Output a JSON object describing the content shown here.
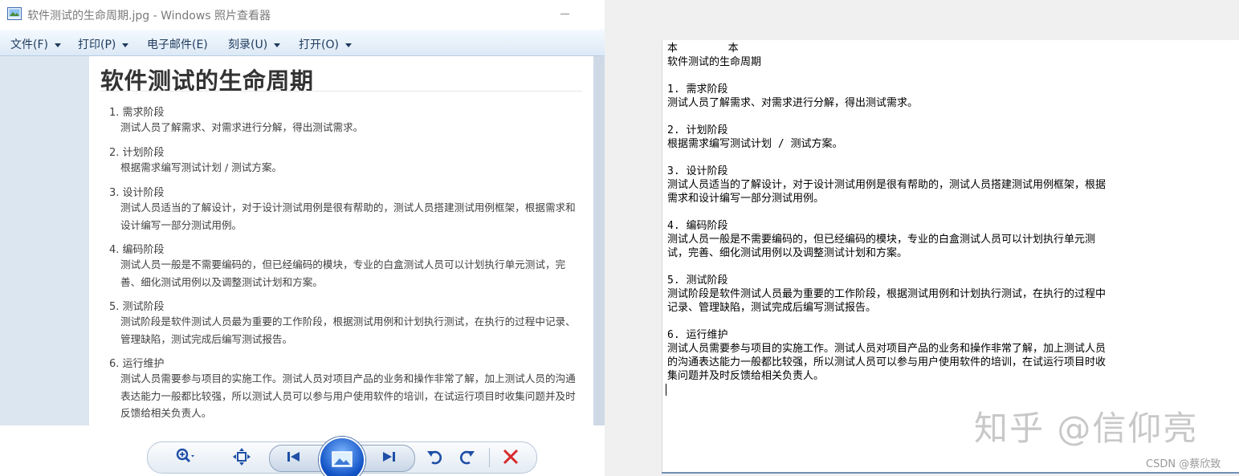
{
  "window": {
    "title": "软件测试的生命周期.jpg - Windows 照片查看器"
  },
  "menu": [
    {
      "label": "文件(F)"
    },
    {
      "label": "打印(P)"
    },
    {
      "label": "电子邮件(E)"
    },
    {
      "label": "刻录(U)"
    },
    {
      "label": "打开(O)"
    }
  ],
  "photo": {
    "title": "软件测试的生命周期",
    "sections": [
      {
        "head": "1. 需求阶段",
        "body": "测试人员了解需求、对需求进行分解，得出测试需求。"
      },
      {
        "head": "2. 计划阶段",
        "body": "根据需求编写测试计划 / 测试方案。"
      },
      {
        "head": "3. 设计阶段",
        "body": "测试人员适当的了解设计，对于设计测试用例是很有帮助的，测试人员搭建测试用例框架，根据需求和设计编写一部分测试用例。"
      },
      {
        "head": "4. 编码阶段",
        "body": "测试人员一般是不需要编码的，但已经编码的模块，专业的白盒测试人员可以计划执行单元测试，完善、细化测试用例以及调整测试计划和方案。"
      },
      {
        "head": "5. 测试阶段",
        "body": "测试阶段是软件测试人员最为重要的工作阶段，根据测试用例和计划执行测试，在执行的过程中记录、管理缺陷，测试完成后编写测试报告。"
      },
      {
        "head": "6. 运行维护",
        "body": "测试人员需要参与项目的实施工作。测试人员对项目产品的业务和操作非常了解，加上测试人员的沟通表达能力一般都比较强，所以测试人员可以参与用户使用软件的培训，在试运行项目时收集问题并及时反馈给相关负责人。"
      }
    ]
  },
  "editor": {
    "text": "本        本\n软件测试的生命周期\n\n1. 需求阶段\n测试人员了解需求、对需求进行分解，得出测试需求。\n\n2. 计划阶段\n根据需求编写测试计划 / 测试方案。\n\n3. 设计阶段\n测试人员适当的了解设计，对于设计测试用例是很有帮助的，测试人员搭建测试用例框架，根据\n需求和设计编写一部分测试用例。\n\n4. 编码阶段\n测试人员一般是不需要编码的，但已经编码的模块，专业的白盒测试人员可以计划执行单元测\n试，完善、细化测试用例以及调整测试计划和方案。\n\n5. 测试阶段\n测试阶段是软件测试人员最为重要的工作阶段，根据测试用例和计划执行测试，在执行的过程中\n记录、管理缺陷，测试完成后编写测试报告。\n\n6. 运行维护\n测试人员需要参与项目的实施工作。测试人员对项目产品的业务和操作非常了解，加上测试人员\n的沟通表达能力一般都比较强，所以测试人员可以参与用户使用软件的培训，在试运行项目时收\n集问题并及时反馈给相关负责人。"
  },
  "watermark": "知乎 @信仰亮",
  "credit": "CSDN @蔡欣致",
  "controls": {
    "zoom_icon": "magnifier-icon",
    "fit_icon": "fit-window-icon",
    "prev_icon": "previous-icon",
    "slideshow_icon": "slideshow-icon",
    "next_icon": "next-icon",
    "rotate_ccw_icon": "rotate-left-icon",
    "rotate_cw_icon": "rotate-right-icon",
    "delete_icon": "delete-icon"
  },
  "colors": {
    "accent": "#1f4fa6",
    "delete": "#d62b2b",
    "menubar": "#dce9f6"
  }
}
